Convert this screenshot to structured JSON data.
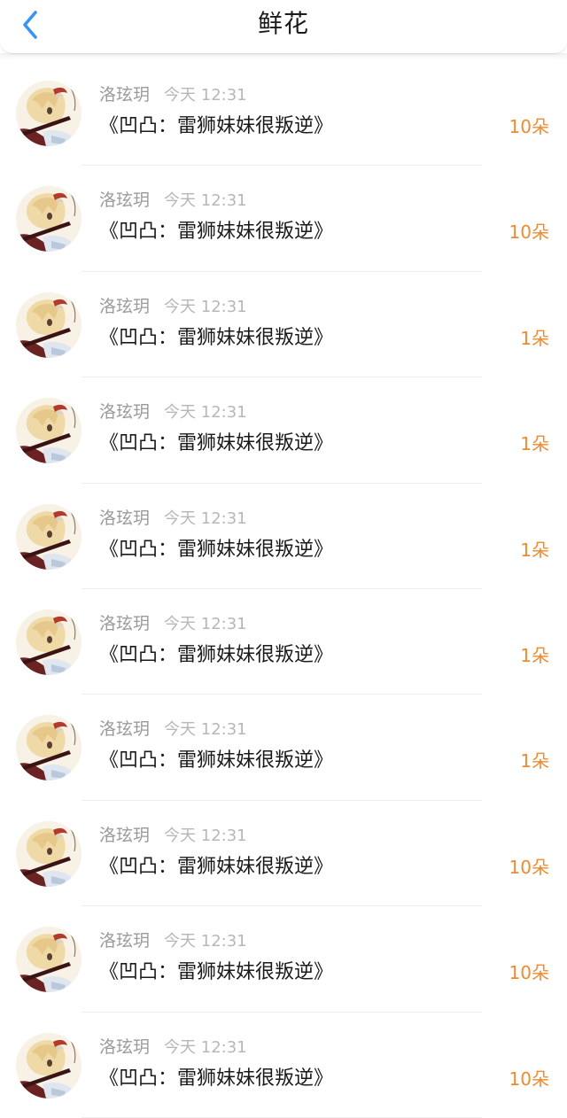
{
  "header": {
    "title": "鲜花",
    "back_icon": "chevron-left-icon",
    "accent_color": "#3a94f0"
  },
  "colors": {
    "amount": "#f08a2e",
    "name": "#9a9a9a",
    "time": "#b7b7b7",
    "title": "#1a1a1a"
  },
  "items": [
    {
      "user": "洛玹玥",
      "time": "今天 12:31",
      "title": "《凹凸：雷狮妹妹很叛逆》",
      "amount": "10朵"
    },
    {
      "user": "洛玹玥",
      "time": "今天 12:31",
      "title": "《凹凸：雷狮妹妹很叛逆》",
      "amount": "10朵"
    },
    {
      "user": "洛玹玥",
      "time": "今天 12:31",
      "title": "《凹凸：雷狮妹妹很叛逆》",
      "amount": "1朵"
    },
    {
      "user": "洛玹玥",
      "time": "今天 12:31",
      "title": "《凹凸：雷狮妹妹很叛逆》",
      "amount": "1朵"
    },
    {
      "user": "洛玹玥",
      "time": "今天 12:31",
      "title": "《凹凸：雷狮妹妹很叛逆》",
      "amount": "1朵"
    },
    {
      "user": "洛玹玥",
      "time": "今天 12:31",
      "title": "《凹凸：雷狮妹妹很叛逆》",
      "amount": "1朵"
    },
    {
      "user": "洛玹玥",
      "time": "今天 12:31",
      "title": "《凹凸：雷狮妹妹很叛逆》",
      "amount": "1朵"
    },
    {
      "user": "洛玹玥",
      "time": "今天 12:31",
      "title": "《凹凸：雷狮妹妹很叛逆》",
      "amount": "10朵"
    },
    {
      "user": "洛玹玥",
      "time": "今天 12:31",
      "title": "《凹凸：雷狮妹妹很叛逆》",
      "amount": "10朵"
    },
    {
      "user": "洛玹玥",
      "time": "今天 12:31",
      "title": "《凹凸：雷狮妹妹很叛逆》",
      "amount": "10朵"
    }
  ]
}
